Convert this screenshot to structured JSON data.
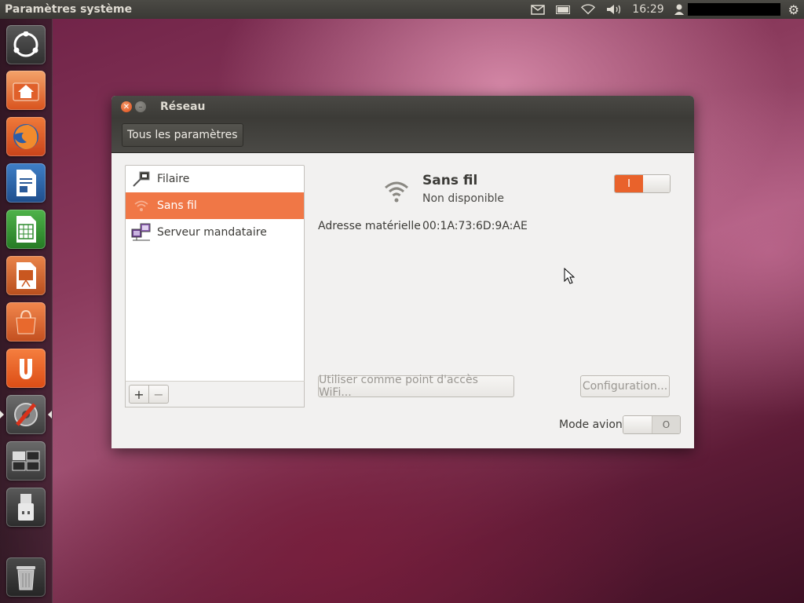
{
  "top_panel": {
    "app_title": "Paramètres système",
    "clock": "16:29",
    "indicators": [
      "mail-icon",
      "battery-icon",
      "wifi-icon",
      "volume-icon",
      "user-icon",
      "gear-icon"
    ]
  },
  "launcher": {
    "items": [
      "dash-home",
      "home-folder",
      "firefox",
      "libreoffice-writer",
      "libreoffice-calc",
      "libreoffice-impress",
      "software-center",
      "ubuntu-one",
      "system-settings",
      "workspace-switcher",
      "usb-drive",
      "trash"
    ]
  },
  "window": {
    "title": "Réseau",
    "all_settings_label": "Tous les paramètres",
    "connections": [
      {
        "label": "Filaire",
        "icon": "wired-network-icon"
      },
      {
        "label": "Sans fil",
        "icon": "wireless-icon",
        "selected": true
      },
      {
        "label": "Serveur mandataire",
        "icon": "proxy-server-icon"
      }
    ],
    "add_label": "+",
    "remove_label": "−",
    "detail": {
      "title": "Sans fil",
      "status": "Non disponible",
      "mac_label": "Adresse matérielle",
      "mac_value": "00:1A:73:6D:9A:AE",
      "wifi_toggle_label": "I",
      "hotspot_button": "Utiliser comme point d'accès WiFi...",
      "config_button": "Configuration...",
      "airplane_label": "Mode avion",
      "airplane_toggle_label": "O"
    }
  },
  "colors": {
    "accent": "#f07746",
    "panel": "#3c3b37"
  }
}
